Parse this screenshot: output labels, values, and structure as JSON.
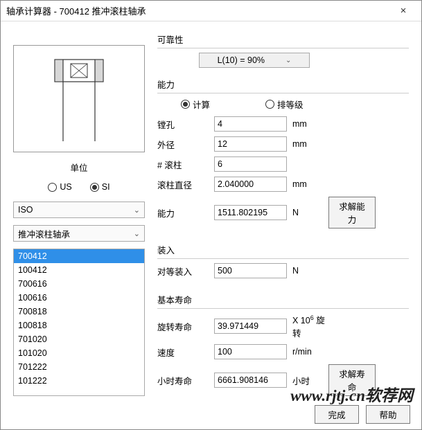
{
  "window": {
    "title": "轴承计算器 - 700412 推冲滚柱轴承"
  },
  "left": {
    "unit_label": "单位",
    "unit_us": "US",
    "unit_si": "SI",
    "standard": "ISO",
    "type": "推冲滚柱轴承",
    "list": [
      "700412",
      "100412",
      "700616",
      "100616",
      "700818",
      "100818",
      "701020",
      "101020",
      "701222",
      "101222"
    ]
  },
  "reliability": {
    "label": "可靠性",
    "value": "L(10)  =  90%"
  },
  "capacity": {
    "label": "能力",
    "opt_calc": "计算",
    "opt_rank": "排等级",
    "rows": {
      "bore": {
        "label": "镗孔",
        "value": "4",
        "unit": "mm"
      },
      "od": {
        "label": "外径",
        "value": "12",
        "unit": "mm"
      },
      "rollers": {
        "label": "# 滚柱",
        "value": "6",
        "unit": ""
      },
      "diam": {
        "label": "滚柱直径",
        "value": "2.040000",
        "unit": "mm"
      },
      "cap": {
        "label": "能力",
        "value": "1511.802195",
        "unit": "N"
      }
    },
    "solve": "求解能力"
  },
  "install": {
    "label": "装入",
    "eq": {
      "label": "对等装入",
      "value": "500",
      "unit": "N"
    }
  },
  "life": {
    "label": "基本寿命",
    "rev": {
      "label": "旋转寿命",
      "value": "39.971449",
      "unit_prefix": "X 10",
      "unit_sup": "6",
      "unit_suffix": " 旋转"
    },
    "speed": {
      "label": "速度",
      "value": "100",
      "unit": "r/min"
    },
    "hour": {
      "label": "小时寿命",
      "value": "6661.908146",
      "unit": "小时"
    },
    "solve": "求解寿命"
  },
  "footer": {
    "done": "完成",
    "help": "帮助"
  },
  "watermark": "www.rjtj.cn软荐网"
}
